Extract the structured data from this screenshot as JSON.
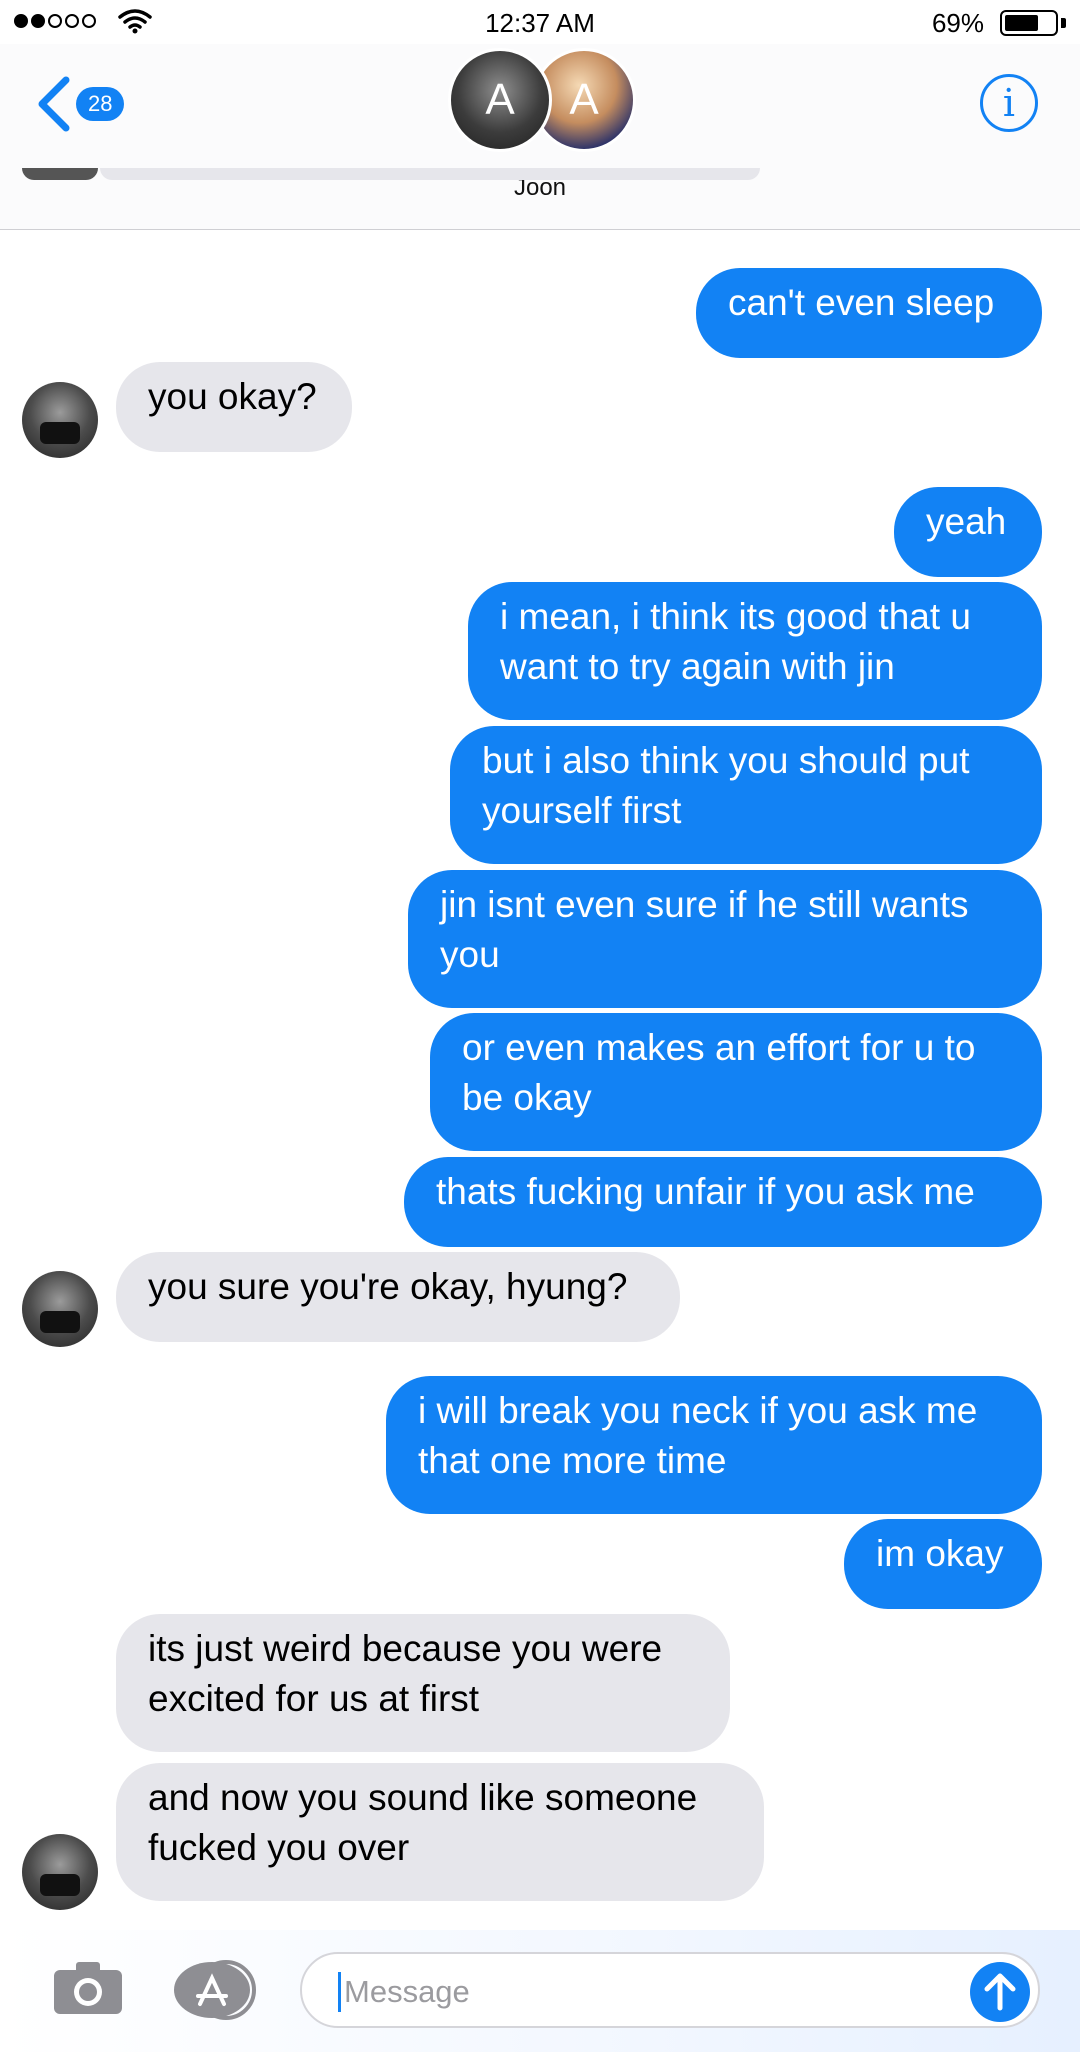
{
  "status_bar": {
    "time": "12:37 AM",
    "battery_percent": "69%",
    "battery_level": 0.69
  },
  "header": {
    "back_count": "28",
    "contact_name": "Joon",
    "avatar_initials": [
      "A",
      "A"
    ],
    "info_label": "i"
  },
  "messages": [
    {
      "sender": "me",
      "text": "can't even sleep"
    },
    {
      "sender": "them",
      "text": "you okay?"
    },
    {
      "sender": "me",
      "text": "yeah"
    },
    {
      "sender": "me",
      "text": "i mean, i think its good that u want to try again with jin"
    },
    {
      "sender": "me",
      "text": "but i also think you should put yourself first"
    },
    {
      "sender": "me",
      "text": "jin isnt even sure if he still wants you"
    },
    {
      "sender": "me",
      "text": "or even makes an effort for u to be okay"
    },
    {
      "sender": "me",
      "text": "thats fucking unfair if you ask me"
    },
    {
      "sender": "them",
      "text": "you sure you're okay, hyung?"
    },
    {
      "sender": "me",
      "text": "i will break you neck if you ask me that one more time"
    },
    {
      "sender": "me",
      "text": "im okay"
    },
    {
      "sender": "them",
      "text": "its just weird because you were excited for us at first"
    },
    {
      "sender": "them",
      "text": "and now you sound like someone fucked you over"
    }
  ],
  "input": {
    "placeholder": "Message"
  },
  "colors": {
    "accent": "#1282f4",
    "incoming_bubble": "#e6e6eb",
    "outgoing_text": "#ffffff"
  }
}
